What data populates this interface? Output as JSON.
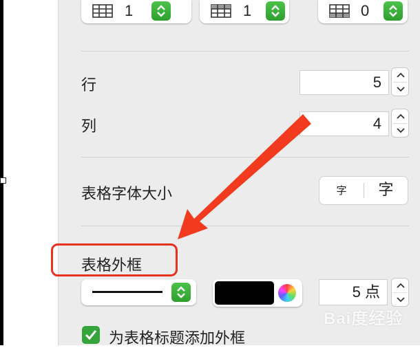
{
  "header_controls": {
    "header_rows": "1",
    "header_columns": "1",
    "footer_rows": "0"
  },
  "rows": {
    "label": "行",
    "value": "5"
  },
  "columns": {
    "label": "列",
    "value": "4"
  },
  "font_size": {
    "label": "表格字体大小",
    "smaller": "字",
    "larger": "字"
  },
  "table_border": {
    "label": "表格外框",
    "width_value": "5 点",
    "color": "#000000"
  },
  "title_border_checkbox": {
    "label": "为表格标题添加外框",
    "checked": true
  },
  "annotation": {
    "arrow_color": "#f23b1e",
    "box_color": "#e8311f"
  },
  "watermark": {
    "text": "Bai度经验"
  },
  "accent_green": "#35a43a"
}
